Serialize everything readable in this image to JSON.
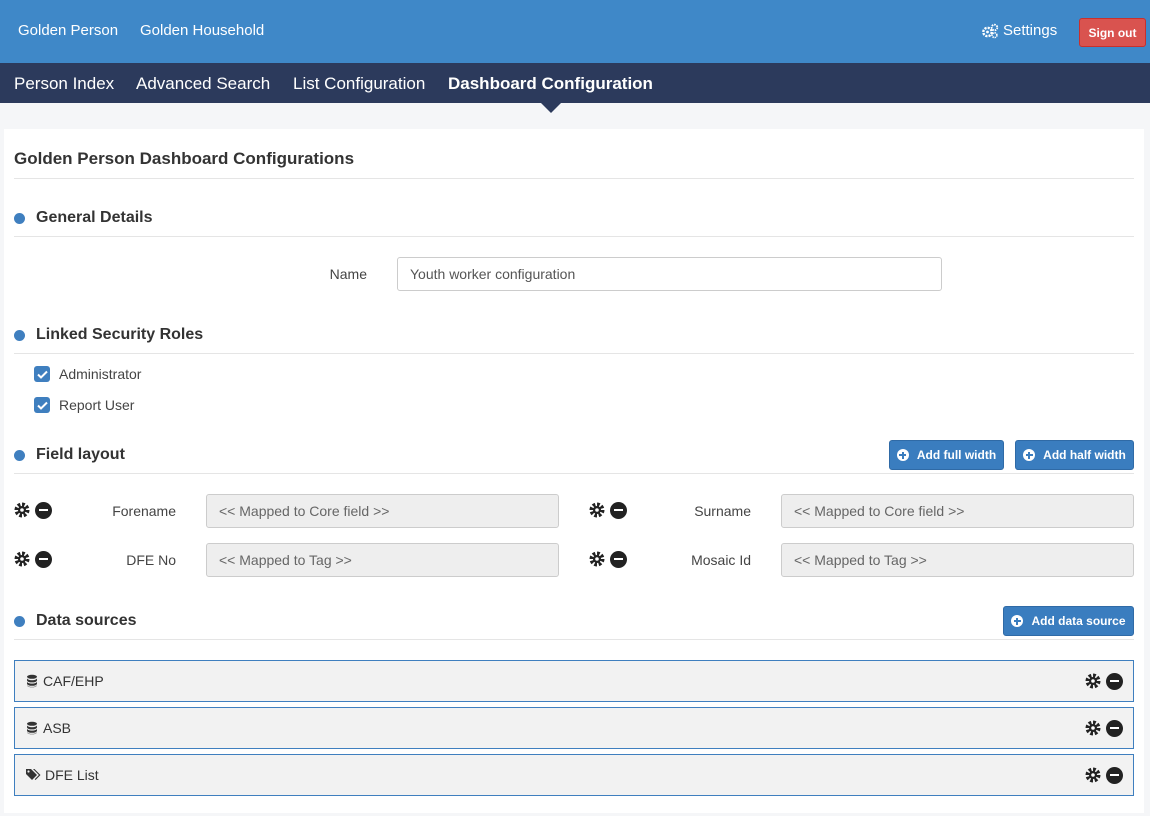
{
  "topbar": {
    "nav": [
      "Golden Person",
      "Golden Household"
    ],
    "settings_label": "Settings",
    "signout_label": "Sign out"
  },
  "subnav": {
    "tabs": [
      "Person Index",
      "Advanced Search",
      "List Configuration",
      "Dashboard Configuration"
    ],
    "active": "Dashboard Configuration"
  },
  "page": {
    "title": "Golden Person Dashboard Configurations"
  },
  "general": {
    "heading": "General Details",
    "name_label": "Name",
    "name_value": "Youth worker configuration"
  },
  "roles": {
    "heading": "Linked Security Roles",
    "items": [
      {
        "label": "Administrator",
        "checked": true
      },
      {
        "label": "Report User",
        "checked": true
      }
    ]
  },
  "field_layout": {
    "heading": "Field layout",
    "add_full_width": "Add full width",
    "add_half_width": "Add half width",
    "fields": [
      {
        "label": "Forename",
        "value": "<< Mapped to Core field >>"
      },
      {
        "label": "Surname",
        "value": "<< Mapped to Core field >>"
      },
      {
        "label": "DFE No",
        "value": "<< Mapped to Tag >>"
      },
      {
        "label": "Mosaic Id",
        "value": "<< Mapped to Tag >>"
      }
    ]
  },
  "data_sources": {
    "heading": "Data sources",
    "add_label": "Add data source",
    "items": [
      {
        "label": "CAF/EHP",
        "icon": "database-icon"
      },
      {
        "label": "ASB",
        "icon": "database-icon"
      },
      {
        "label": "DFE List",
        "icon": "tags-icon"
      }
    ]
  },
  "colors": {
    "topbar": "#3f88c8",
    "subnav": "#2c3a5c",
    "signout": "#d9534f",
    "primary": "#3a7dbf"
  }
}
